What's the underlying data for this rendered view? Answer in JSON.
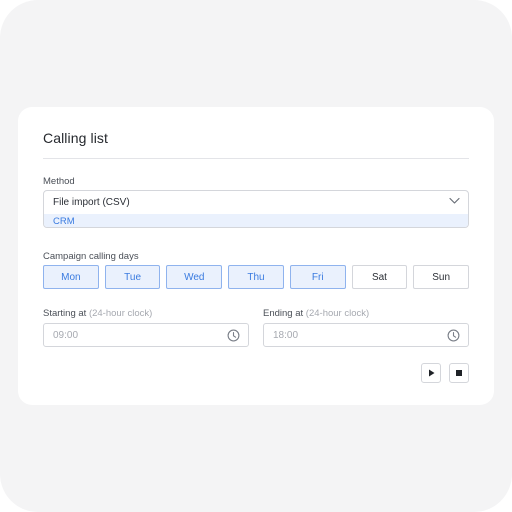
{
  "panel": {
    "title": "Calling list"
  },
  "method": {
    "label": "Method",
    "selected": "File import (CSV)",
    "highlighted_option": "CRM"
  },
  "campaign": {
    "label": "Campaign calling days",
    "days": [
      {
        "label": "Mon",
        "selected": true
      },
      {
        "label": "Tue",
        "selected": true
      },
      {
        "label": "Wed",
        "selected": true
      },
      {
        "label": "Thu",
        "selected": true
      },
      {
        "label": "Fri",
        "selected": true
      },
      {
        "label": "Sat",
        "selected": false
      },
      {
        "label": "Sun",
        "selected": false
      }
    ]
  },
  "start": {
    "label": "Starting at",
    "hint": "(24-hour clock)",
    "value": "09:00"
  },
  "end": {
    "label": "Ending at",
    "hint": "(24-hour clock)",
    "value": "18:00"
  },
  "controls": {
    "play_icon": "play-icon",
    "stop_icon": "stop-icon"
  },
  "colors": {
    "accent": "#3a7be0",
    "selected_bg": "#eaf1fd",
    "selected_border": "#8fb3ee"
  }
}
